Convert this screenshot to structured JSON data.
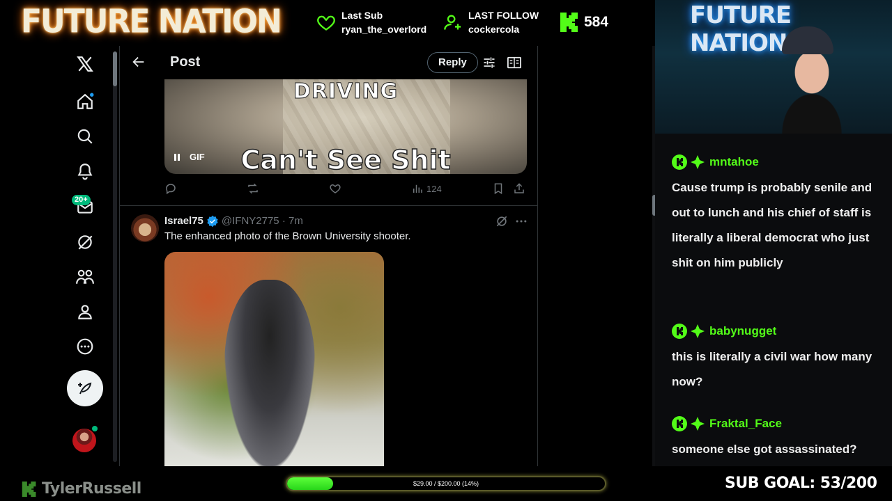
{
  "overlay": {
    "brand": "FUTURE NATION",
    "last_sub_label": "Last Sub",
    "last_sub_user": "ryan_the_overlord",
    "last_follow_label": "LAST FOLLOW",
    "last_follow_user": "cockercola",
    "kick_count": "584",
    "webcam_sign": "FUTURE NATION",
    "channel_name": "TylerRussell",
    "goal_text": "$29.00 / $200.00 (14%)",
    "goal_fraction": 0.145,
    "sub_goal": "SUB GOAL: 53/200",
    "accent": "#53fc18"
  },
  "x_nav": {
    "items": [
      "x-logo-icon",
      "home-icon",
      "search-icon",
      "bell-icon",
      "mail-icon",
      "grok-icon",
      "communities-icon",
      "profile-icon",
      "more-icon"
    ],
    "messages_badge": "20+"
  },
  "post": {
    "title": "Post",
    "reply_label": "Reply",
    "gif": {
      "caption_top": "DRIVING",
      "caption_bottom": "Can't See Shit",
      "badge": "GIF"
    },
    "views": "124",
    "tweet2": {
      "name": "Israel75",
      "handle": "@IFNY2775 · 7m",
      "text": "The enhanced photo of the Brown University shooter."
    }
  },
  "chat": {
    "messages": [
      {
        "user": "mntahoe",
        "text": "Cause trump is probably senile and out to lunch and his chief of staff is literally a liberal democrat who just shit on him publicly"
      },
      {
        "user": "babynugget",
        "text": "this is literally a civil war how many now?"
      },
      {
        "user": "Fraktal_Face",
        "text": "someone else got assassinated?"
      }
    ]
  }
}
